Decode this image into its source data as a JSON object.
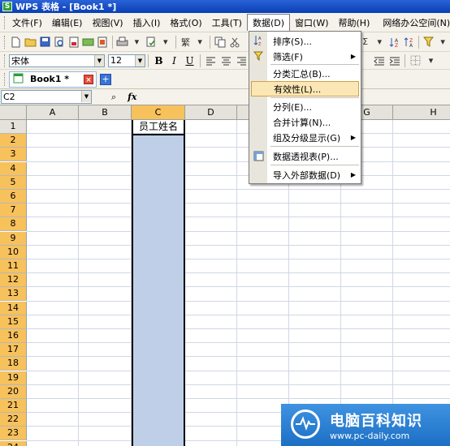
{
  "window": {
    "app_icon": "S",
    "title": "WPS 表格 - [Book1 *]"
  },
  "menubar": {
    "items": [
      "文件(F)",
      "编辑(E)",
      "视图(V)",
      "插入(I)",
      "格式(O)",
      "工具(T)",
      "数据(D)",
      "窗口(W)",
      "帮助(H)",
      "网络办公空间(N) ▾"
    ],
    "active": "数据(D)"
  },
  "toolbar": {
    "font": "宋体",
    "size": "12",
    "bold": "B",
    "italic": "I",
    "underline": "U",
    "trad": "繁"
  },
  "tabs": {
    "doc": "Book1 *",
    "close": "×",
    "new": "+"
  },
  "formula": {
    "namebox": "C2",
    "fx": "fx",
    "search": "⌕"
  },
  "sheet": {
    "columns": [
      "A",
      "B",
      "C",
      "D",
      "E",
      "F",
      "G",
      "H"
    ],
    "rows": [
      "1",
      "2",
      "3",
      "4",
      "5",
      "6",
      "7",
      "8",
      "9",
      "10",
      "11",
      "12",
      "13",
      "14",
      "15",
      "16",
      "17",
      "18",
      "19",
      "20",
      "21",
      "22",
      "23",
      "24"
    ],
    "selected_column": "C",
    "c1_value": "员工姓名"
  },
  "data_menu": {
    "items": [
      {
        "label": "排序(S)...",
        "icon": "sort-icon",
        "submenu": false
      },
      {
        "label": "筛选(F)",
        "icon": "filter-icon",
        "submenu": true
      },
      {
        "label": "分类汇总(B)...",
        "icon": "",
        "submenu": false
      },
      {
        "label": "有效性(L)...",
        "icon": "",
        "submenu": false,
        "highlighted": true
      },
      {
        "label": "分列(E)...",
        "icon": "",
        "submenu": false
      },
      {
        "label": "合并计算(N)...",
        "icon": "",
        "submenu": false
      },
      {
        "label": "组及分级显示(G)",
        "icon": "",
        "submenu": true
      },
      {
        "label": "数据透视表(P)...",
        "icon": "pivot-icon",
        "submenu": false
      },
      {
        "label": "导入外部数据(D)",
        "icon": "",
        "submenu": true
      }
    ]
  },
  "watermark": {
    "title": "电脑百科知识",
    "url": "www.pc-daily.com"
  },
  "colors": {
    "selected_header": "#f7c15c",
    "selection_fill": "#c0cfe8",
    "menu_highlight": "#fbe7b5"
  }
}
